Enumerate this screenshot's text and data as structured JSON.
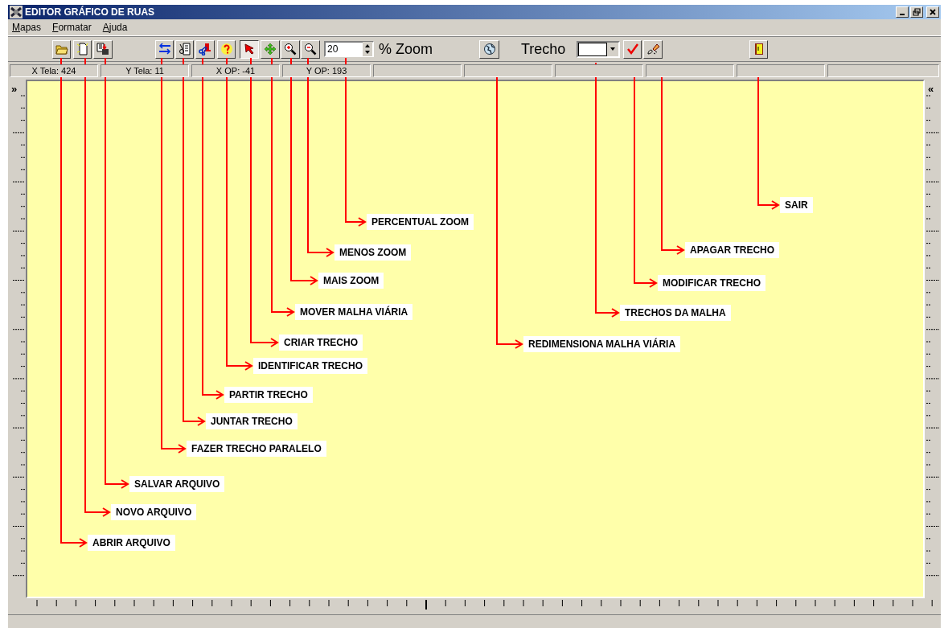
{
  "window": {
    "title": "EDITOR GRÁFICO DE RUAS"
  },
  "menu": [
    {
      "label": "Mapas"
    },
    {
      "label": "Formatar"
    },
    {
      "label": "Ajuda"
    }
  ],
  "toolbar": [
    {
      "kind": "button",
      "selected": false
    },
    {
      "kind": "button",
      "selected": false
    },
    {
      "kind": "button",
      "selected": false
    },
    {
      "kind": "button",
      "selected": false
    },
    {
      "kind": "button",
      "selected": false
    },
    {
      "kind": "button",
      "selected": false
    },
    {
      "kind": "button",
      "selected": false
    },
    {
      "kind": "button",
      "selected": true
    },
    {
      "kind": "button",
      "selected": false
    },
    {
      "kind": "button",
      "selected": false
    },
    {
      "kind": "button",
      "selected": false
    },
    {
      "kind": "spin",
      "value": "20"
    },
    {
      "kind": "label",
      "text": "% Zoom"
    },
    {
      "kind": "button",
      "selected": false
    },
    {
      "kind": "label",
      "text": "Trecho"
    },
    {
      "kind": "combo"
    },
    {
      "kind": "button",
      "selected": false
    },
    {
      "kind": "button",
      "selected": false
    },
    {
      "kind": "button",
      "selected": false
    }
  ],
  "status_bar": [
    "X Tela: 424",
    "Y Tela: 11",
    "X OP: -41",
    "Y OP: 193"
  ],
  "rulers": {
    "left_marker": "»",
    "right_marker": "«"
  },
  "annotations": [
    {
      "label": "SAIR"
    },
    {
      "label": "PERCENTUAL ZOOM"
    },
    {
      "label": "MENOS ZOOM"
    },
    {
      "label": "APAGAR TRECHO"
    },
    {
      "label": "MAIS ZOOM"
    },
    {
      "label": "MODIFICAR TRECHO"
    },
    {
      "label": "MOVER MALHA VIÁRIA"
    },
    {
      "label": "TRECHOS DA MALHA"
    },
    {
      "label": "CRIAR TRECHO"
    },
    {
      "label": "REDIMENSIONA MALHA VIÁRIA"
    },
    {
      "label": "IDENTIFICAR TRECHO"
    },
    {
      "label": "PARTIR TRECHO"
    },
    {
      "label": "JUNTAR TRECHO"
    },
    {
      "label": "FAZER TRECHO PARALELO"
    },
    {
      "label": "SALVAR ARQUIVO"
    },
    {
      "label": "NOVO ARQUIVO"
    },
    {
      "label": "ABRIR ARQUIVO"
    }
  ]
}
